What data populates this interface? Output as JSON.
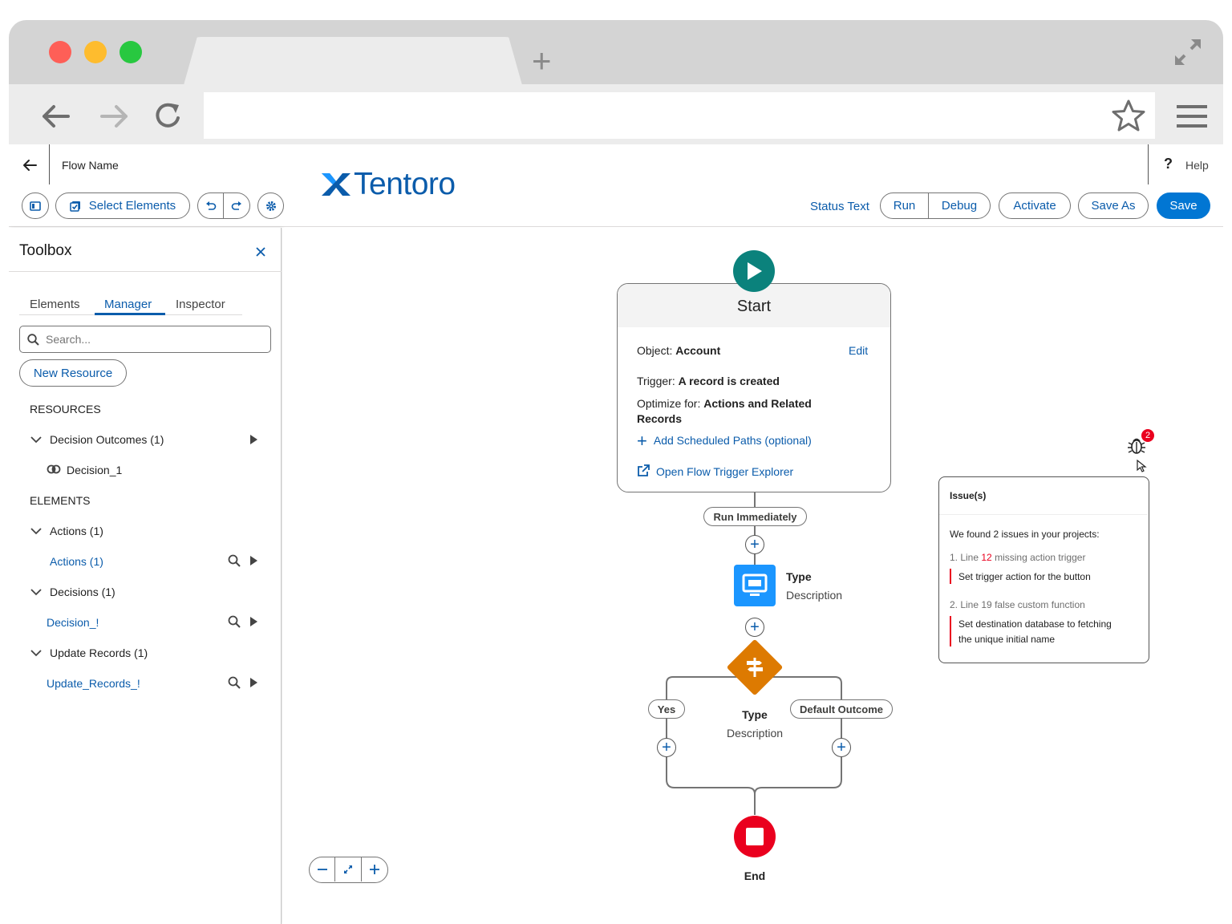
{
  "header": {
    "flow_name": "Flow Name",
    "help_label": "Help",
    "help_glyph": "?",
    "logo_text": "Tentoro",
    "select_elements_label": "Select Elements",
    "status_text": "Status Text",
    "run_label": "Run",
    "debug_label": "Debug",
    "activate_label": "Activate",
    "save_as_label": "Save As",
    "save_label": "Save"
  },
  "toolbox": {
    "title": "Toolbox",
    "tabs": [
      "Elements",
      "Manager",
      "Inspector"
    ],
    "active_tab": "Manager",
    "search_placeholder": "Search...",
    "new_resource_label": "New Resource",
    "resources_heading": "RESOURCES",
    "decision_outcomes_label": "Decision Outcomes (1)",
    "decision_1_label": "Decision_1",
    "elements_heading": "ELEMENTS",
    "actions_group_label": "Actions (1)",
    "actions_item_label": "Actions (1)",
    "decisions_group_label": "Decisions (1)",
    "decision_item_label": "Decision_!",
    "update_records_group_label": "Update Records (1)",
    "update_records_item_label": "Update_Records_!"
  },
  "start_card": {
    "title": "Start",
    "object_key": "Object:",
    "object_value": "Account",
    "edit_label": "Edit",
    "trigger_key": "Trigger:",
    "trigger_value": "A record is created",
    "optimize_key": "Optimize for:",
    "optimize_value_1": "Actions and Related",
    "optimize_value_2": "Records",
    "add_paths_label": "Add Scheduled Paths (optional)",
    "explorer_label": "Open Flow Trigger Explorer"
  },
  "flow": {
    "run_immediately": "Run Immediately",
    "action_type": "Type",
    "action_description": "Description",
    "decision_type": "Type",
    "decision_description": "Description",
    "yes_label": "Yes",
    "default_outcome_label": "Default Outcome",
    "end_label": "End"
  },
  "issues": {
    "badge_count": "2",
    "title": "Issue(s)",
    "summary": "We found 2 issues in your projects:",
    "items": [
      {
        "prefix": "1. Line ",
        "line": "12",
        "suffix": " missing action trigger",
        "fix_1": "Set trigger action for the button",
        "fix_2": ""
      },
      {
        "prefix": "2. Line ",
        "line": "19",
        "suffix": " false custom function",
        "fix_1": "Set destination database to fetching",
        "fix_2": "the unique initial name"
      }
    ]
  },
  "colors": {
    "brand_blue": "#0b5cab",
    "save_blue": "#0176d3",
    "start_teal": "#0b827c",
    "action_blue": "#1b96ff",
    "decision_orange": "#dd7a01",
    "end_red": "#ea001e",
    "error_red": "#ea001e"
  }
}
